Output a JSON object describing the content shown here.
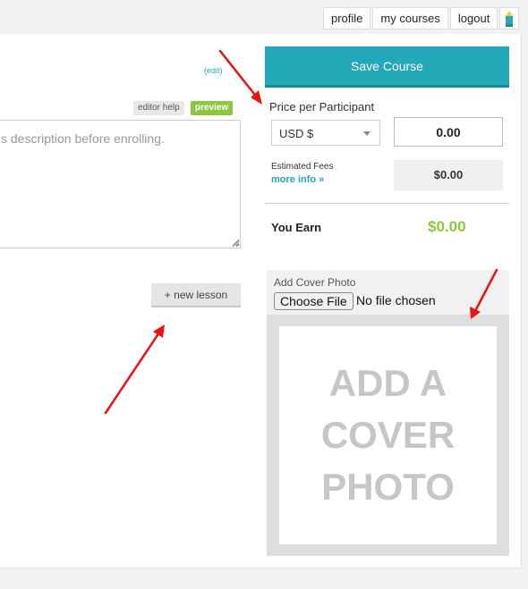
{
  "topnav": {
    "profile": "profile",
    "my_courses": "my courses",
    "logout": "logout"
  },
  "course": {
    "edit_link": "(edit)",
    "editor_help": "editor help",
    "preview": "preview",
    "description_text": "s description before enrolling.",
    "new_lesson": "+ new lesson"
  },
  "sidebar": {
    "save_button": "Save Course",
    "price_label": "Price per Participant",
    "currency_selected": "USD $",
    "price_value": "0.00",
    "fees_label": "Estimated Fees",
    "more_info": "more info »",
    "fees_value": "$0.00",
    "earn_label": "You Earn",
    "earn_value": "$0.00"
  },
  "cover_photo": {
    "label": "Add Cover Photo",
    "choose_file": "Choose File",
    "no_file": "No file chosen",
    "placeholder_text": "ADD A COVER PHOTO"
  },
  "colors": {
    "accent": "#22a8b7",
    "earn": "#8dc63f",
    "annotation_arrow": "#ee1111"
  },
  "icons": [
    "pencil-icon",
    "dropdown-caret-icon",
    "resize-grip-icon",
    "annotation-arrow-icon"
  ]
}
